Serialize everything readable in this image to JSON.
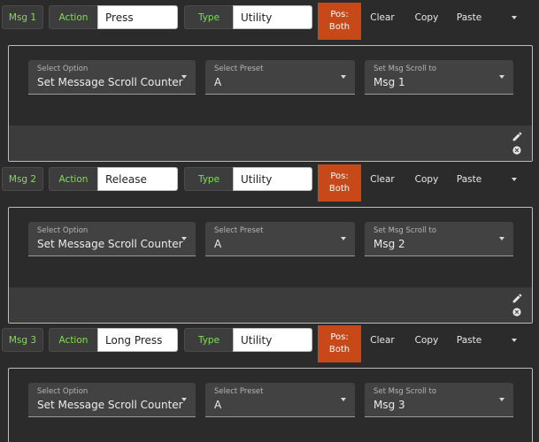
{
  "messages": [
    {
      "badge": "Msg 1",
      "action_label": "Action",
      "action_value": "Press",
      "type_label": "Type",
      "type_value": "Utility",
      "pos_line1": "Pos:",
      "pos_line2": "Both",
      "clear": "Clear",
      "copy": "Copy",
      "paste": "Paste",
      "select_option_label": "Select Option",
      "select_option_value": "Set Message Scroll Counter",
      "select_preset_label": "Select Preset",
      "select_preset_value": "A",
      "scroll_label": "Set Msg Scroll to",
      "scroll_value": "Msg 1"
    },
    {
      "badge": "Msg 2",
      "action_label": "Action",
      "action_value": "Release",
      "type_label": "Type",
      "type_value": "Utility",
      "pos_line1": "Pos:",
      "pos_line2": "Both",
      "clear": "Clear",
      "copy": "Copy",
      "paste": "Paste",
      "select_option_label": "Select Option",
      "select_option_value": "Set Message Scroll Counter",
      "select_preset_label": "Select Preset",
      "select_preset_value": "A",
      "scroll_label": "Set Msg Scroll to",
      "scroll_value": "Msg 2"
    },
    {
      "badge": "Msg 3",
      "action_label": "Action",
      "action_value": "Long Press",
      "type_label": "Type",
      "type_value": "Utility",
      "pos_line1": "Pos:",
      "pos_line2": "Both",
      "clear": "Clear",
      "copy": "Copy",
      "paste": "Paste",
      "select_option_label": "Select Option",
      "select_option_value": "Set Message Scroll Counter",
      "select_preset_label": "Select Preset",
      "select_preset_value": "A",
      "scroll_label": "Set Msg Scroll to",
      "scroll_value": "Msg 3"
    }
  ],
  "colors": {
    "accent_green": "#7be04f",
    "pos_orange": "#c7491a",
    "background": "#2b2b2b"
  },
  "icons": [
    "chevron-down-icon",
    "pencil-icon",
    "close-circle-icon"
  ]
}
